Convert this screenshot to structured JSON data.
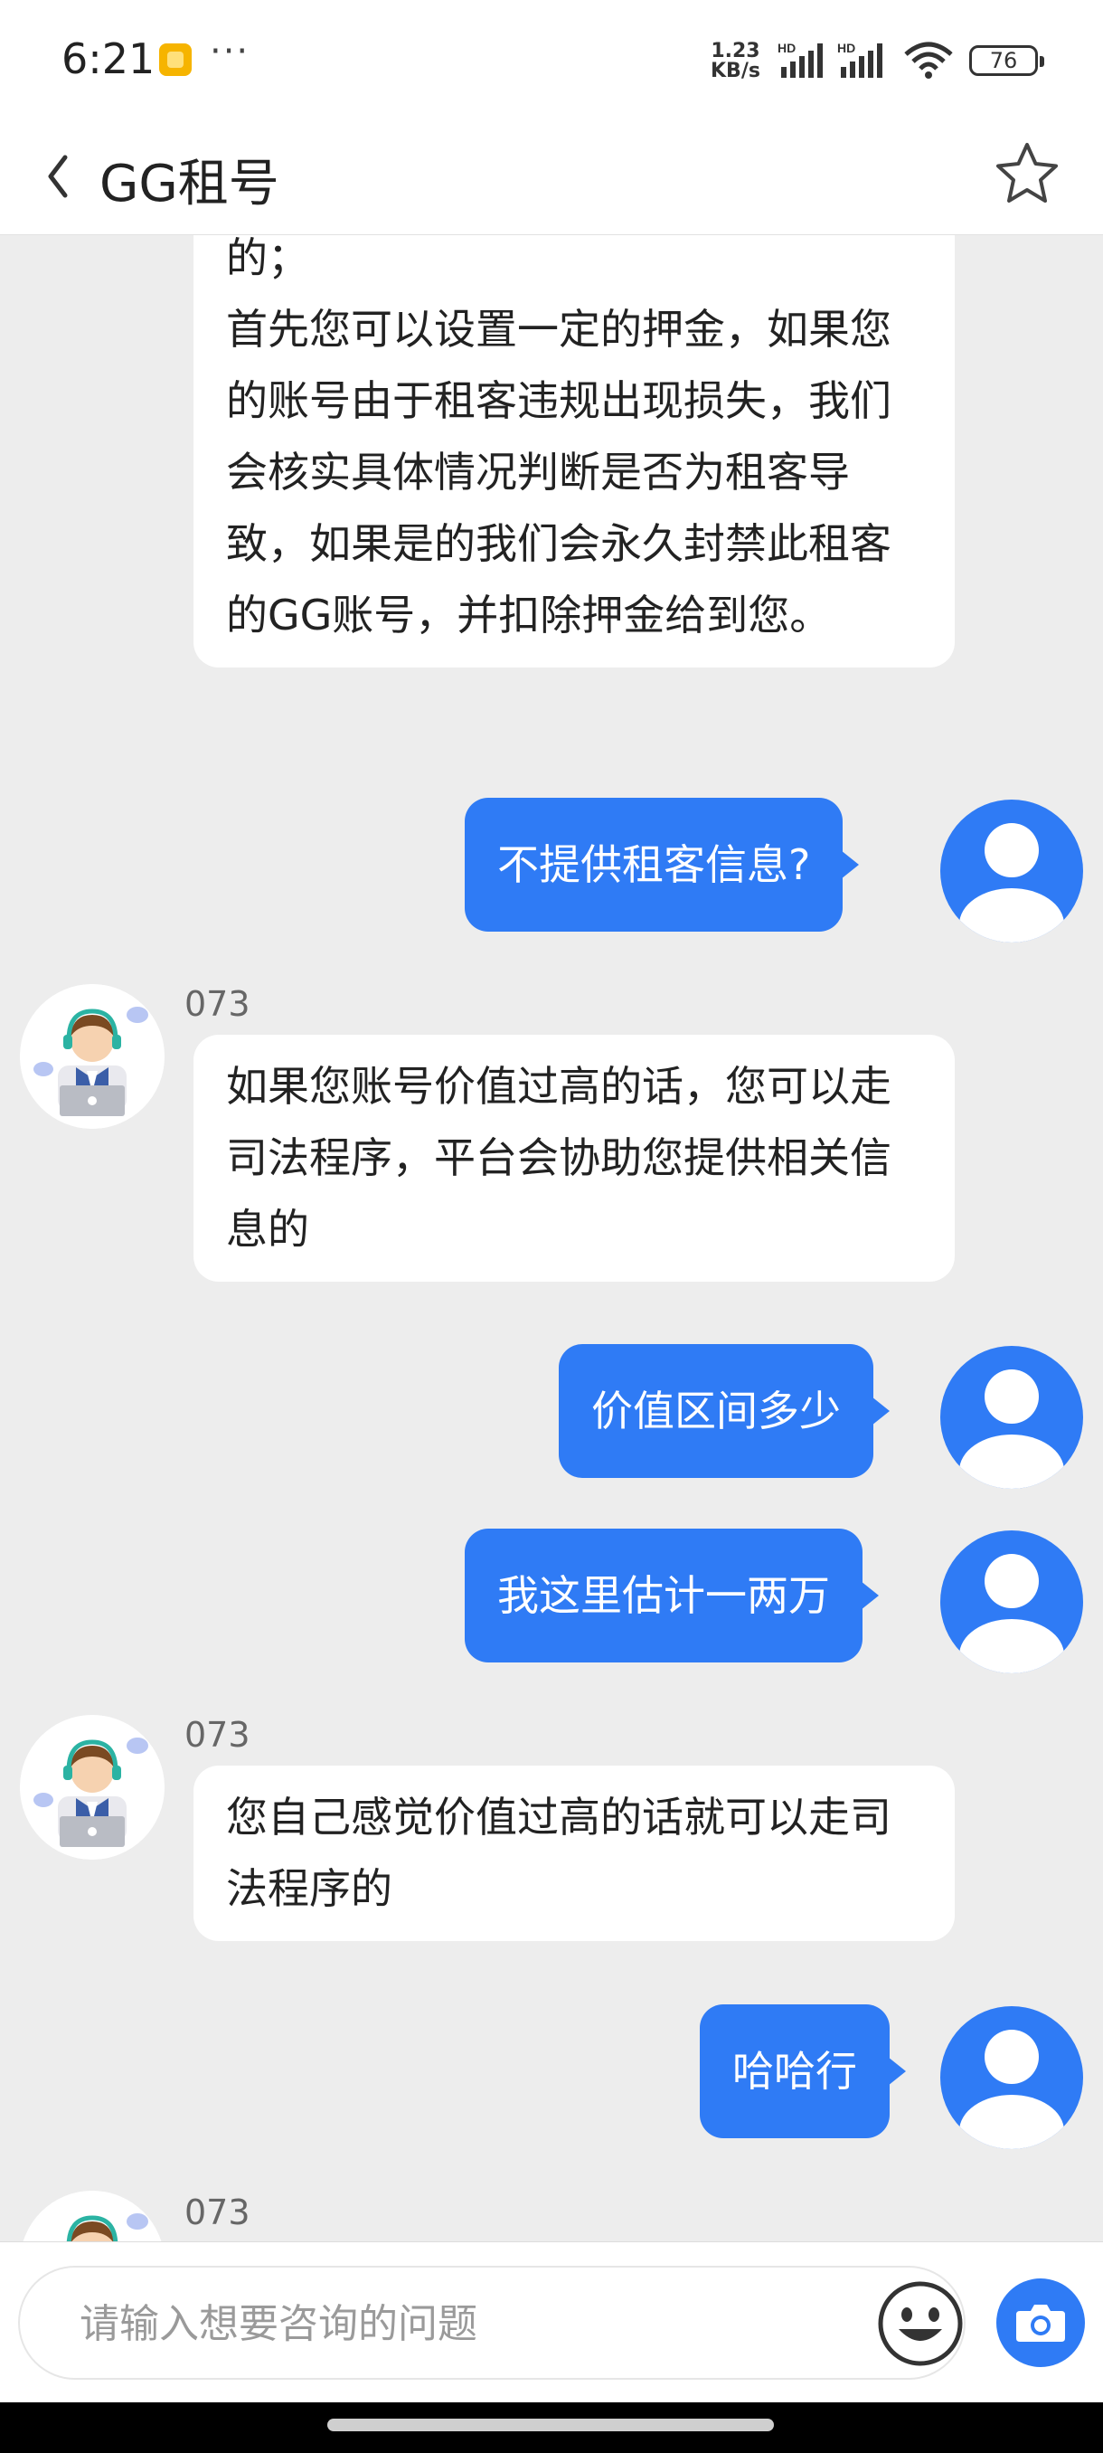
{
  "status_bar": {
    "time": "6:21",
    "more": "···",
    "net_speed_value": "1.23",
    "net_speed_unit": "KB/s",
    "sim1": "HD",
    "sim2": "HD",
    "battery": "76"
  },
  "header": {
    "title": "GG租号",
    "back_icon": "chevron-left-icon",
    "star_icon": "star-outline-icon"
  },
  "messages": [
    {
      "from": "agent",
      "text": "的；\n首先您可以设置一定的押金，如果您的账号由于租客违规出现损失，我们会核实具体情况判断是否为租客导致，如果是的我们会永久封禁此租客的GG账号，并扣除押金给到您。"
    },
    {
      "from": "user",
      "text": "不提供租客信息?"
    },
    {
      "from": "agent",
      "name": "073",
      "text": "如果您账号价值过高的话，您可以走司法程序，平台会协助您提供相关信息的"
    },
    {
      "from": "user",
      "text": "价值区间多少"
    },
    {
      "from": "user",
      "text": "我这里估计一两万"
    },
    {
      "from": "agent",
      "name": "073",
      "text": "您自己感觉价值过高的话就可以走司法程序的"
    },
    {
      "from": "user",
      "text": "哈哈行"
    },
    {
      "from": "agent",
      "name": "073",
      "text": ""
    }
  ],
  "input": {
    "placeholder": "请输入想要咨询的问题",
    "emoji_icon": "smiley-icon",
    "camera_icon": "camera-icon"
  },
  "colors": {
    "accent": "#2f7bf5",
    "background": "#ededed"
  }
}
